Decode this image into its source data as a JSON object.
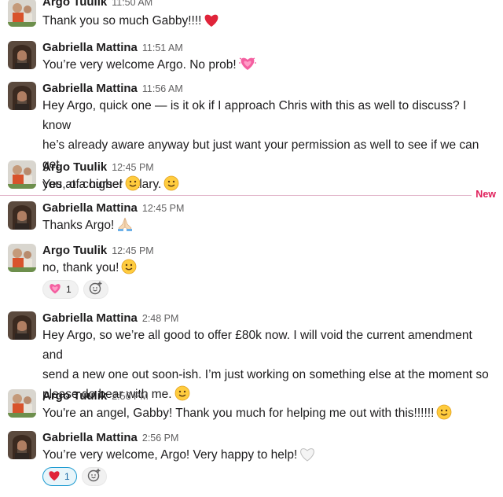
{
  "divider": {
    "label": "New"
  },
  "messages": [
    {
      "author": "Argo Tuulik",
      "time": "11:50 AM",
      "lines": [
        "Thank you so much Gabby!!!!"
      ],
      "emoji": "red-heart"
    },
    {
      "author": "Gabriella Mattina",
      "time": "11:51 AM",
      "lines": [
        "You’re very welcome Argo. No prob!"
      ],
      "emoji": "heartpulse"
    },
    {
      "author": "Gabriella Mattina",
      "time": "11:56 AM",
      "lines": [
        "Hey Argo, quick one —  is it ok if I approach Chris with this as well to discuss? I know",
        "he’s already aware anyway but just want your permission as well to see if we can get",
        "you at a higher salary."
      ],
      "emoji": "slightly-smiling-face"
    },
    {
      "author": "Argo Tuulik",
      "time": "12:45 PM",
      "lines": [
        "Yes, of course!"
      ],
      "emoji": "slightly-smiling-face"
    },
    {
      "author": "Gabriella Mattina",
      "time": "12:45 PM",
      "lines": [
        "Thanks Argo!"
      ],
      "emoji": "folded-hands"
    },
    {
      "author": "Argo Tuulik",
      "time": "12:45 PM",
      "lines": [
        "no, thank you!"
      ],
      "emoji": "slightly-smiling-face",
      "reactions": [
        {
          "emoji": "heartpulse",
          "count": "1"
        }
      ]
    },
    {
      "author": "Gabriella Mattina",
      "time": "2:48 PM",
      "lines": [
        "Hey Argo, so we’re all good to offer £80k now. I will void the current amendment and",
        "send a new one out soon-ish. I’m just working on something else at the moment so",
        "please do bear with me."
      ],
      "emoji": "slightly-smiling-face"
    },
    {
      "author": "Argo Tuulik",
      "time": "2:56 PM",
      "lines": [
        "You're an angel, Gabby! Thank you much for helping me out with this!!!!!!"
      ],
      "emoji": "slightly-smiling-face"
    },
    {
      "author": "Gabriella Mattina",
      "time": "2:56 PM",
      "lines": [
        "You’re very welcome, Argo! Very happy to help!"
      ],
      "emoji": "white-heart",
      "reactions": [
        {
          "emoji": "red-heart",
          "count": "1"
        }
      ]
    }
  ]
}
